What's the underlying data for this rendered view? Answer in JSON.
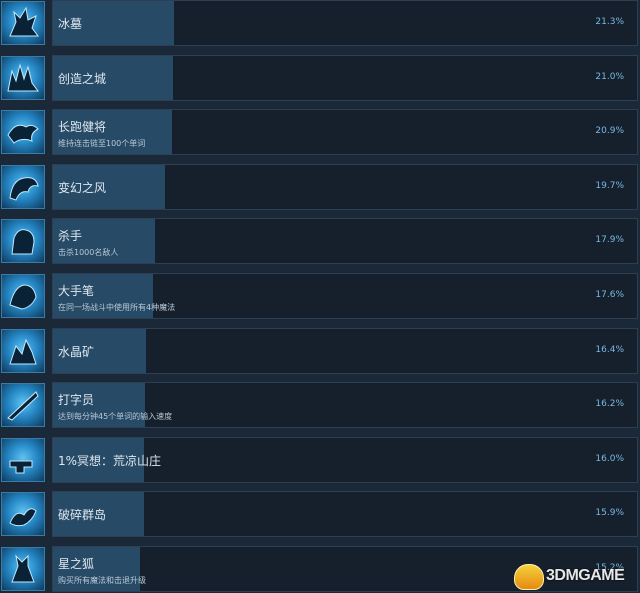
{
  "achievements": [
    {
      "title": "冰墓",
      "desc": "",
      "percent_text": "21.3%",
      "percent": 21.3,
      "icon": "ice-wolf-icon"
    },
    {
      "title": "创造之城",
      "desc": "",
      "percent_text": "21.0%",
      "percent": 21.0,
      "icon": "city-wolf-icon"
    },
    {
      "title": "长跑健将",
      "desc": "维持连击链至100个单词",
      "percent_text": "20.9%",
      "percent": 20.9,
      "icon": "running-fox-icon"
    },
    {
      "title": "变幻之风",
      "desc": "",
      "percent_text": "19.7%",
      "percent": 19.7,
      "icon": "wind-fox-icon"
    },
    {
      "title": "杀手",
      "desc": "击杀1000名敌人",
      "percent_text": "17.9%",
      "percent": 17.9,
      "icon": "killer-wolf-icon"
    },
    {
      "title": "大手笔",
      "desc": "在同一场战斗中使用所有4种魔法",
      "percent_text": "17.6%",
      "percent": 17.6,
      "icon": "magic-wolf-icon"
    },
    {
      "title": "水晶矿",
      "desc": "",
      "percent_text": "16.4%",
      "percent": 16.4,
      "icon": "crystal-wolf-icon"
    },
    {
      "title": "打字员",
      "desc": "达到每分钟45个单词的输入速度",
      "percent_text": "16.2%",
      "percent": 16.2,
      "icon": "quill-icon"
    },
    {
      "title": "1%冥想：荒凉山庄",
      "desc": "",
      "percent_text": "16.0%",
      "percent": 16.0,
      "icon": "anvil-icon"
    },
    {
      "title": "破碎群岛",
      "desc": "",
      "percent_text": "15.9%",
      "percent": 15.9,
      "icon": "islands-fox-icon"
    },
    {
      "title": "星之狐",
      "desc": "购买所有魔法和击退升级",
      "percent_text": "15.2%",
      "percent": 15.2,
      "icon": "star-fox-icon"
    }
  ],
  "watermark": {
    "text": "3DMGAME",
    "icon": "3dm-mascot-icon"
  },
  "colors": {
    "background": "#1b2838",
    "card": "#16202d",
    "bar": "#274a66",
    "percent": "#79b8e0",
    "icon_glow": "#5fc2f0"
  }
}
